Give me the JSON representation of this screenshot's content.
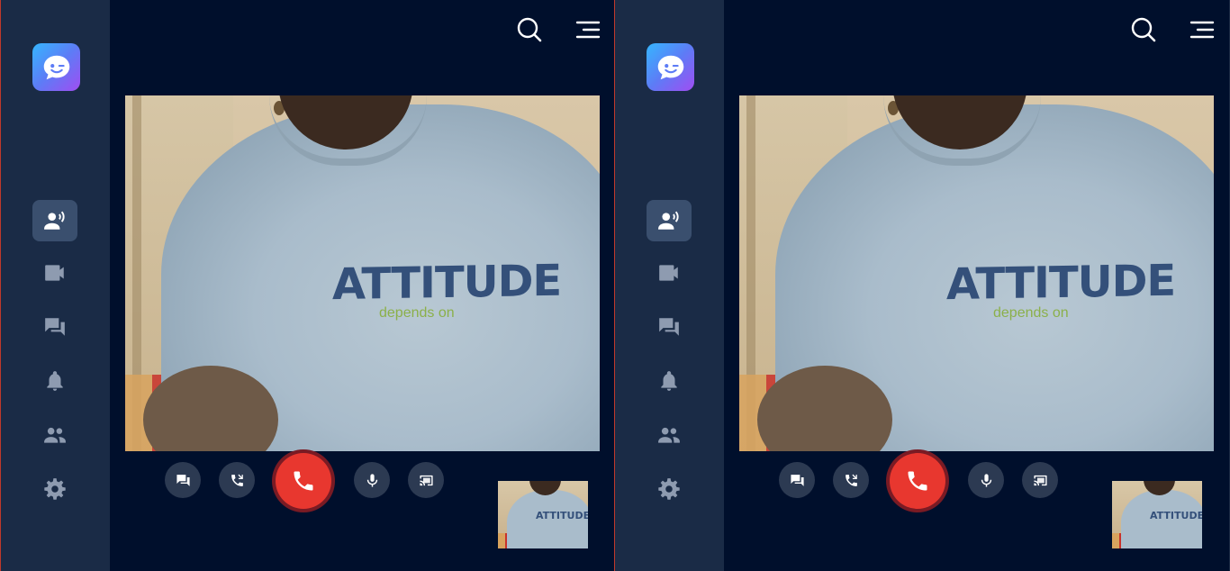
{
  "app": {
    "logo": "chat-bubble-logo"
  },
  "header": {
    "icons": [
      "search-icon",
      "menu-icon"
    ]
  },
  "sidebar": {
    "items": [
      {
        "icon": "voice-call-icon",
        "active": true
      },
      {
        "icon": "video-call-icon",
        "active": false
      },
      {
        "icon": "chat-icon",
        "active": false
      },
      {
        "icon": "bell-icon",
        "active": false
      },
      {
        "icon": "contacts-icon",
        "active": false
      },
      {
        "icon": "gear-icon",
        "active": false
      }
    ]
  },
  "video": {
    "shirt_text": "ATTITUDE",
    "shirt_subtext": "depends on"
  },
  "controls": {
    "buttons": [
      "chat-icon",
      "phone-forward-icon",
      "hang-up-icon",
      "microphone-icon",
      "cast-icon"
    ]
  },
  "colors": {
    "background": "#000f2c",
    "sidebar": "#1a2b46",
    "hangup": "#e8372f",
    "control": "#2c3a52"
  }
}
